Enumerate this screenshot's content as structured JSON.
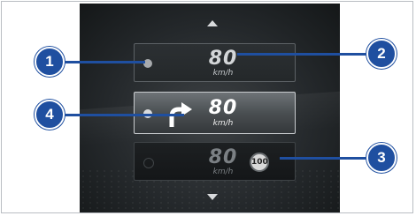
{
  "screen": {
    "items": [
      {
        "speed": "80",
        "unit": "km/h"
      },
      {
        "speed": "80",
        "unit": "km/h"
      },
      {
        "speed": "80",
        "unit": "km/h",
        "limit_sign": "100"
      }
    ]
  },
  "callouts": [
    "1",
    "2",
    "3",
    "4"
  ],
  "colors": {
    "callout": "#1f4fa0",
    "screen_bg": "#25292c"
  },
  "icons": {
    "scroll_up": "arrow-up-icon",
    "scroll_down": "arrow-down-icon",
    "turn": "turn-right-arrow-icon",
    "limit": "speed-limit-sign-icon"
  }
}
